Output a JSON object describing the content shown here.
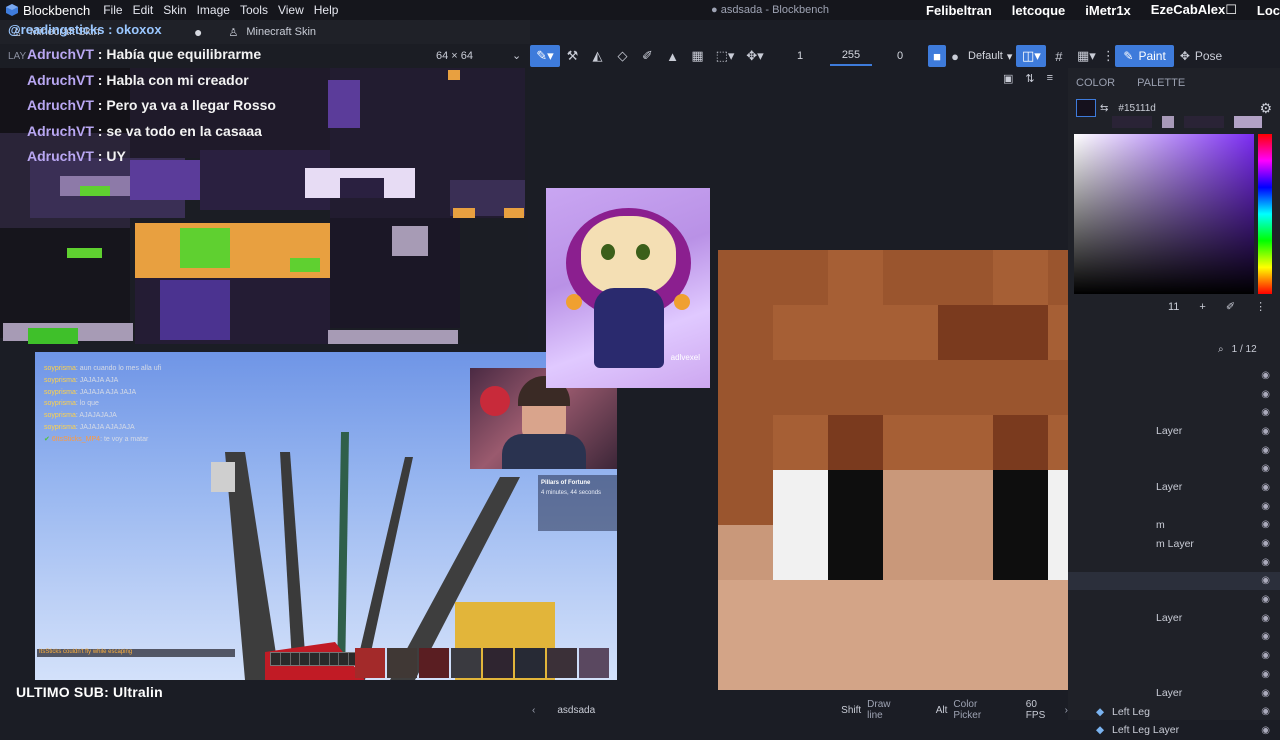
{
  "app": {
    "name": "Blockbench",
    "window_title": "● asdsada - Blockbench",
    "menu": [
      "File",
      "Edit",
      "Skin",
      "Image",
      "Tools",
      "View",
      "Help"
    ]
  },
  "stream_viewers": [
    "Felibeltran",
    "letcoque",
    "iMetr1x",
    "EzeCabAlex☐",
    "Loc"
  ],
  "tabs": [
    {
      "label": "Minecraft Skin"
    },
    {
      "label": "Minecraft Skin"
    }
  ],
  "uv_panel": {
    "header_label": "LAY",
    "resolution": "64 × 64"
  },
  "toolbar": {
    "brush_size": "1",
    "opacity": "255",
    "softness": "0",
    "blend_mode": "Default",
    "paint_label": "Paint",
    "pose_label": "Pose"
  },
  "chat": {
    "top_user": "@readingsticks : okoxox",
    "lines": [
      {
        "user": "AdruchVT",
        "msg": " : Había que equilibrarme"
      },
      {
        "user": "AdruchVT",
        "msg": " : Habla con mi creador"
      },
      {
        "user": "AdruchVT",
        "msg": " : Pero ya va a llegar Rosso"
      },
      {
        "user": "AdruchVT",
        "msg": " : se va todo en la casaaa"
      },
      {
        "user": "AdruchVT",
        "msg": " : UY"
      }
    ]
  },
  "game": {
    "chat_lines": [
      {
        "name": "soyprisma",
        "msg": ": aun cuando lo mes alla ufi"
      },
      {
        "name": "soyprisma",
        "msg": ": JAJAJA AJA"
      },
      {
        "name": "soyprisma",
        "msg": ": JAJAJA AJA JAJA"
      },
      {
        "name": "soyprisma",
        "msg": ": lo que"
      },
      {
        "name": "soyprisma",
        "msg": ": AJAJAJAJA"
      },
      {
        "name": "soyprisma",
        "msg": ": JAJAJA AJAJAJA"
      },
      {
        "name": "6ItsSticks_MP4",
        "msg": ": te voy a matar"
      }
    ],
    "scoreboard_title": "Pillars of Fortune",
    "scoreboard_time": "4 minutes, 44 seconds",
    "death_message": "ItsSticks couldn't fly while escaping"
  },
  "art_handle": "adlvexel",
  "color_panel": {
    "tabs": [
      "COLOR",
      "PALETTE"
    ],
    "hex": "#15111d",
    "value_field": "11"
  },
  "layers": {
    "count": "1 / 12",
    "rows": [
      {
        "label": "",
        "selected": false
      },
      {
        "label": "",
        "selected": false
      },
      {
        "label": "",
        "selected": false
      },
      {
        "label": "Layer",
        "selected": false
      },
      {
        "label": "",
        "selected": false
      },
      {
        "label": "",
        "selected": false
      },
      {
        "label": "Layer",
        "selected": false
      },
      {
        "label": "",
        "selected": false
      },
      {
        "label": "m",
        "selected": false
      },
      {
        "label": "m Layer",
        "selected": false
      },
      {
        "label": "",
        "selected": false
      },
      {
        "label": "",
        "selected": true
      },
      {
        "label": "",
        "selected": false
      },
      {
        "label": "Layer",
        "selected": false
      },
      {
        "label": "",
        "selected": false
      },
      {
        "label": "",
        "selected": false
      },
      {
        "label": "",
        "selected": false
      },
      {
        "label": "Layer",
        "selected": false
      },
      {
        "label": "Left Leg",
        "selected": false
      },
      {
        "label": "Left Leg Layer",
        "selected": false
      }
    ]
  },
  "statusbar": {
    "project": "asdsada",
    "shift_key": "Shift",
    "shift_action": "Draw line",
    "alt_key": "Alt",
    "alt_action": "Color Picker",
    "fps": "60 FPS"
  },
  "last_sub": "ULTIMO SUB: Ultralin",
  "face_colors": {
    "hair_dark": "#7a3a1e",
    "hair": "#9a552e",
    "hair_light": "#a65f35",
    "skin": "#c9987a",
    "skin_light": "#d3a487",
    "white": "#f1f1f1",
    "black": "#0e0e0e"
  }
}
